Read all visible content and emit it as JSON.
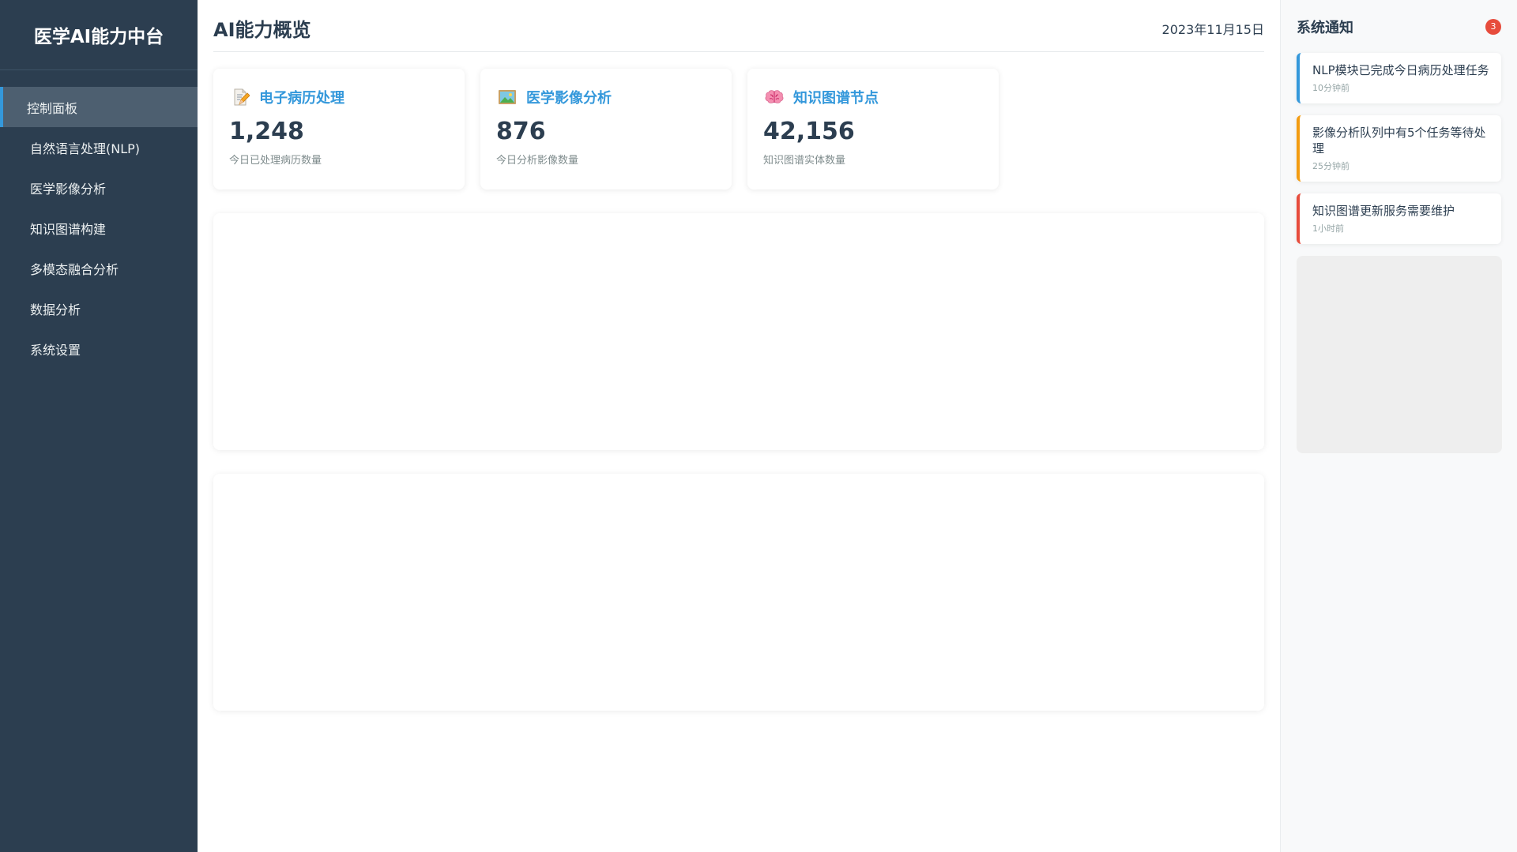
{
  "app": {
    "brand": "医学AI能力中台"
  },
  "sidebar": {
    "items": [
      {
        "label": "控制面板",
        "active": true
      },
      {
        "label": "自然语言处理(NLP)"
      },
      {
        "label": "医学影像分析"
      },
      {
        "label": "知识图谱构建"
      },
      {
        "label": "多模态融合分析"
      },
      {
        "label": "数据分析"
      },
      {
        "label": "系统设置"
      }
    ]
  },
  "header": {
    "title": "AI能力概览",
    "date": "2023年11月15日"
  },
  "stats": [
    {
      "icon": "memo-icon",
      "title": "电子病历处理",
      "value": "1,248",
      "desc": "今日已处理病历数量"
    },
    {
      "icon": "picture-icon",
      "title": "医学影像分析",
      "value": "876",
      "desc": "今日分析影像数量"
    },
    {
      "icon": "brain-icon",
      "title": "知识图谱节点",
      "value": "42,156",
      "desc": "知识图谱实体数量"
    }
  ],
  "notifications": {
    "title": "系统通知",
    "count": "3",
    "items": [
      {
        "text": "NLP模块已完成今日病历处理任务",
        "time": "10分钟前",
        "level": "info"
      },
      {
        "text": "影像分析队列中有5个任务等待处理",
        "time": "25分钟前",
        "level": "warning"
      },
      {
        "text": "知识图谱更新服务需要维护",
        "time": "1小时前",
        "level": "danger"
      }
    ]
  },
  "colors": {
    "sidebar_bg": "#2c3e50",
    "accent": "#3498db",
    "warning": "#f39c12",
    "danger": "#e74c3c"
  }
}
